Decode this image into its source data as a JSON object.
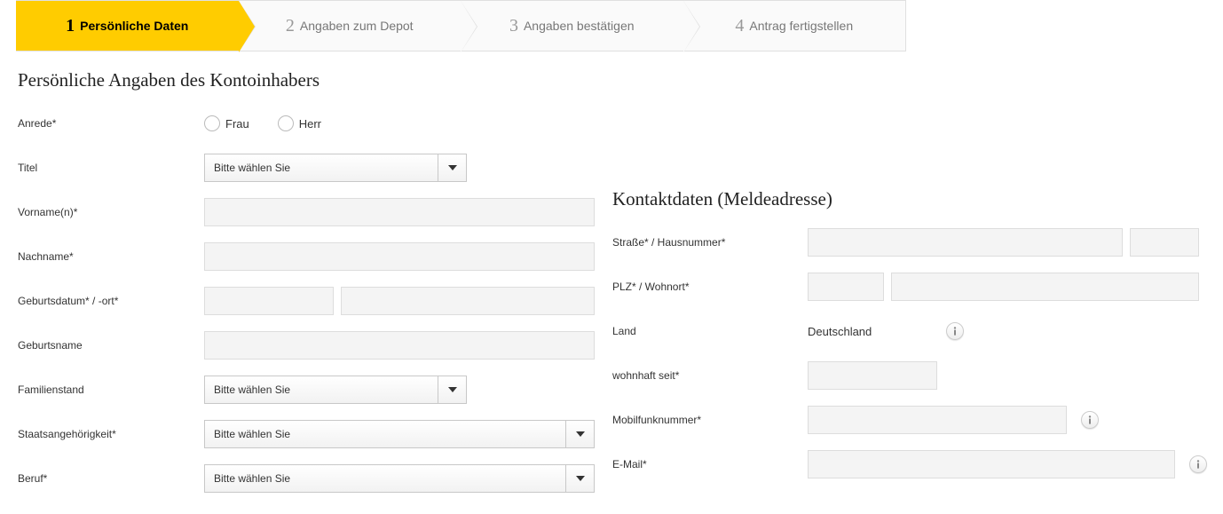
{
  "stepper": {
    "steps": [
      {
        "num": "1",
        "label": "Persönliche Daten",
        "active": true
      },
      {
        "num": "2",
        "label": "Angaben zum Depot",
        "active": false
      },
      {
        "num": "3",
        "label": "Angaben bestätigen",
        "active": false
      },
      {
        "num": "4",
        "label": "Antrag fertigstellen",
        "active": false
      }
    ]
  },
  "left": {
    "heading": "Persönliche Angaben des Kontoinhabers",
    "anrede_label": "Anrede*",
    "anrede_frau": "Frau",
    "anrede_herr": "Herr",
    "titel_label": "Titel",
    "titel_select": "Bitte wählen Sie",
    "vorname_label": "Vorname(n)*",
    "nachname_label": "Nachname*",
    "geburt_label": "Geburtsdatum* / -ort*",
    "geburtsname_label": "Geburtsname",
    "familienstand_label": "Familienstand",
    "familienstand_select": "Bitte wählen Sie",
    "staats_label": "Staatsangehörigkeit*",
    "staats_select": "Bitte wählen Sie",
    "beruf_label": "Beruf*",
    "beruf_select": "Bitte wählen Sie"
  },
  "right": {
    "heading": "Kontaktdaten (Meldeadresse)",
    "strasse_label": "Straße* / Hausnummer*",
    "plz_label": "PLZ* / Wohnort*",
    "land_label": "Land",
    "land_value": "Deutschland",
    "wohnhaft_label": "wohnhaft seit*",
    "mobil_label": "Mobilfunknummer*",
    "email_label": "E-Mail*"
  }
}
